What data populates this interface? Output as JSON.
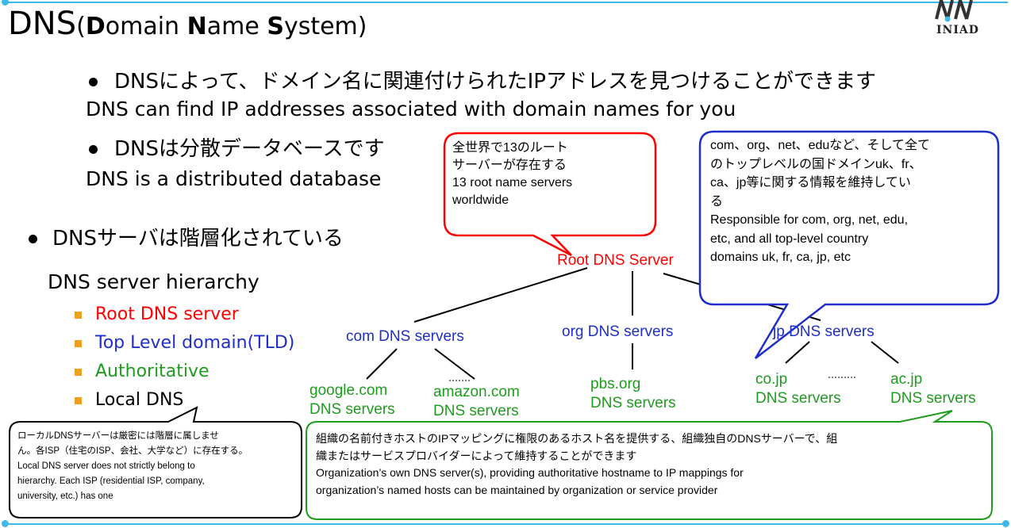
{
  "slide": {
    "title_main": "DNS",
    "title_paren": [
      {
        "t": "(",
        "b": false
      },
      {
        "t": "D",
        "b": true
      },
      {
        "t": "omain ",
        "b": false
      },
      {
        "t": "N",
        "b": true
      },
      {
        "t": "ame ",
        "b": false
      },
      {
        "t": "S",
        "b": true
      },
      {
        "t": "ystem)",
        "b": false
      }
    ],
    "logo_text": "INIAD",
    "bullets": [
      {
        "jp": "DNSによって、ドメイン名に関連付けられたIPアドレスを見つけることができます",
        "en": "DNS can find IP addresses associated with domain names for you"
      },
      {
        "jp": "DNSは分散データベースです",
        "en": "DNS is a distributed database"
      },
      {
        "jp": "DNSサーバは階層化されている",
        "en": "DNS server hierarchy"
      }
    ],
    "hierarchy_levels": [
      {
        "label": "Root DNS server",
        "color": "#ff0000"
      },
      {
        "label": "Top Level domain(TLD)",
        "color": "#1f2fc8"
      },
      {
        "label": "Authoritative",
        "color": "#1e9c1e"
      },
      {
        "label": "Local DNS",
        "color": "#000000"
      }
    ]
  },
  "tree": {
    "root": "Root DNS Server",
    "tld": [
      "com DNS servers",
      "org DNS servers",
      "jp DNS servers"
    ],
    "authoritative": [
      {
        "l1": "google.com",
        "l2": "DNS servers"
      },
      {
        "l1": "amazon.com",
        "l2": "DNS servers"
      },
      {
        "l1": "pbs.org",
        "l2": "DNS servers"
      },
      {
        "l1": "co.jp",
        "l2": "DNS servers"
      },
      {
        "l1": "ac.jp",
        "l2": "DNS servers"
      }
    ]
  },
  "callouts": {
    "root": [
      "全世界で13のルート",
      "サーバーが存在する",
      "13 root name servers",
      "worldwide"
    ],
    "tld": [
      "com、org、net、eduなど、そして全て",
      "のトップレベルの国ドメインuk、fr、",
      "ca、jp等に関する情報を維持してい",
      "る",
      "Responsible for com, org, net, edu,",
      "etc, and all top-level country",
      "domains uk, fr, ca, jp, etc"
    ],
    "local": [
      "ローカルDNSサーバーは厳密には階層に属しませ",
      "ん。各ISP（住宅のISP、会社、大学など）に存在する。",
      "Local DNS server does not strictly belong to",
      "hierarchy. Each ISP (residential ISP, company,",
      "university, etc.) has one"
    ],
    "authoritative": [
      "組織の名前付きホストのIPマッピングに権限のあるホスト名を提供する、組織独自のDNSサーバーで、組",
      "織またはサービスプロバイダーによって維持することができます",
      "Organization’s own DNS server(s), providing authoritative hostname to IP mappings for",
      "organization’s named hosts can be maintained by organization or service provider"
    ]
  },
  "colors": {
    "accent": "#3fb8e8",
    "red": "#ff0000",
    "blue": "#1f2fc8",
    "green": "#1e9c1e",
    "bullet_square": "#f0a020"
  }
}
